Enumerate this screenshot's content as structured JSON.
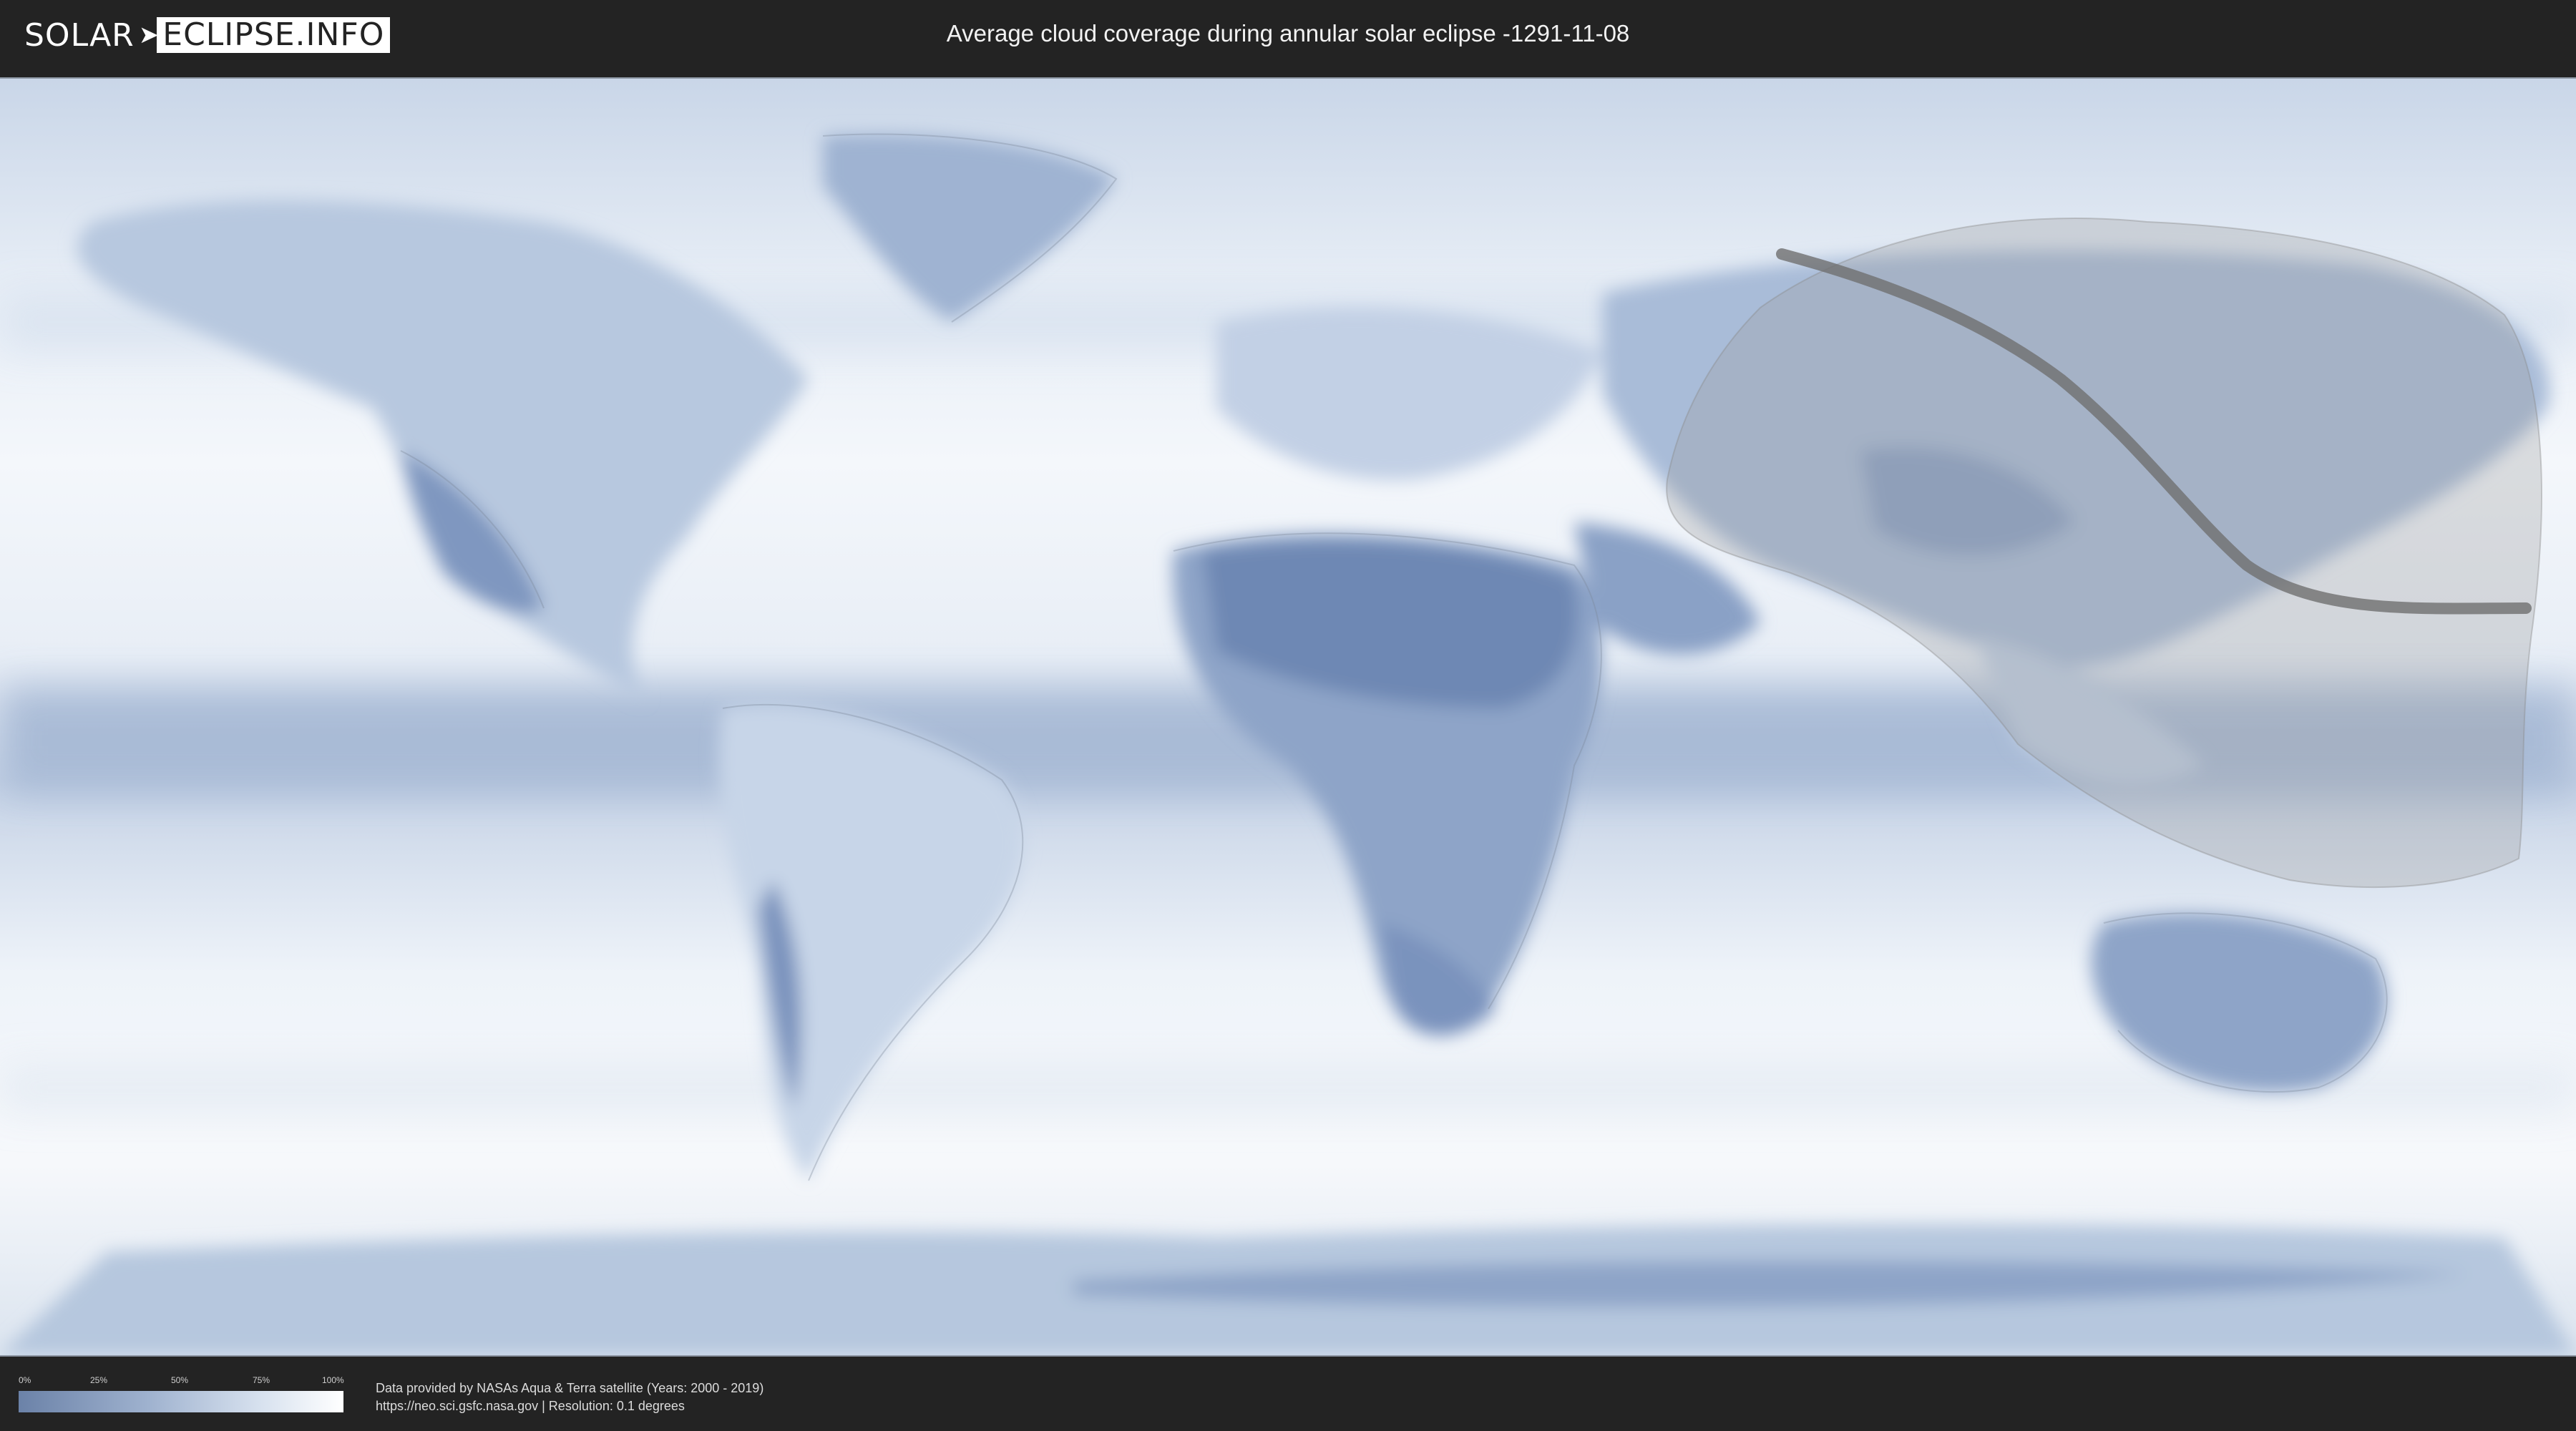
{
  "header": {
    "logo_left": "SOLAR",
    "logo_right": "ECLIPSE.INFO",
    "title": "Average cloud coverage during annular solar eclipse -1291-11-08"
  },
  "legend": {
    "ticks": [
      "0%",
      "25%",
      "50%",
      "75%",
      "100%"
    ],
    "colors": {
      "low": "#6b82a8",
      "high": "#ffffff"
    }
  },
  "credit": {
    "line1": "Data provided by NASAs Aqua & Terra satellite (Years: 2000 - 2019)",
    "line2": "https://neo.sci.gsfc.nasa.gov | Resolution: 0.1 degrees"
  },
  "map": {
    "overlay": "eclipse-visibility-zone",
    "path": "annularity-central-line",
    "colors": {
      "clear": "#7a93bd",
      "cloudy": "#f4f7fb",
      "zone": "#9a9a9a",
      "centerline": "#6f6f6f"
    }
  }
}
